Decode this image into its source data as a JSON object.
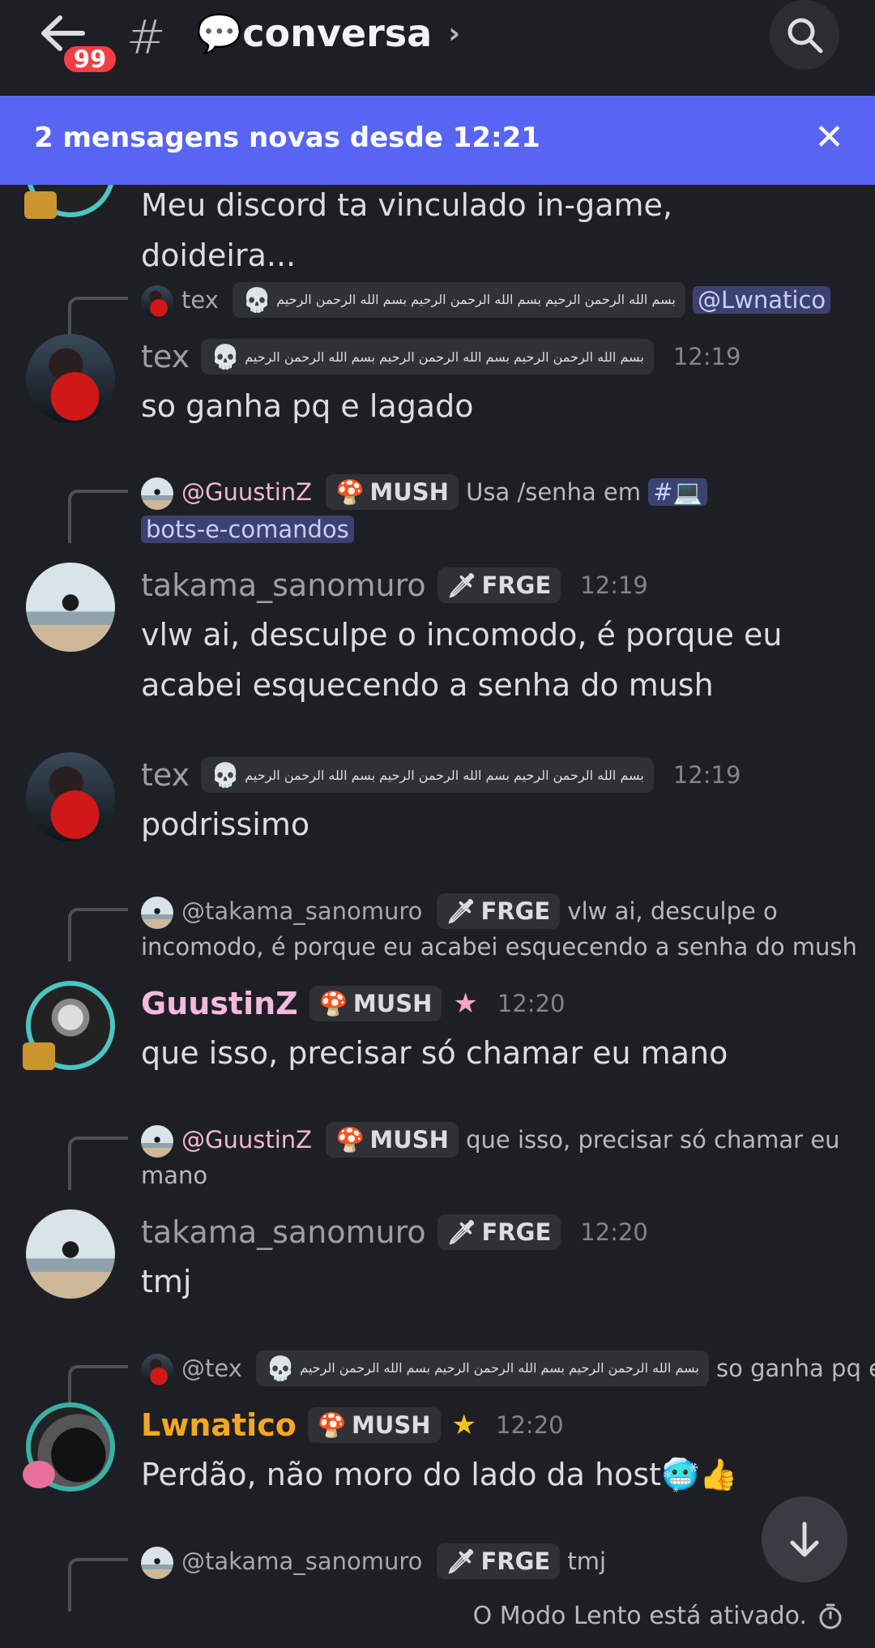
{
  "header": {
    "notification_count": "99",
    "channel_title": "💬conversa",
    "chevron": "›",
    "icons": {
      "back": "arrow-left-icon",
      "hash": "hash-icon",
      "search": "search-icon"
    }
  },
  "banner": {
    "text": "2 mensagens novas desde 12:21",
    "close": "✕"
  },
  "messages": [
    {
      "body": "Meu discord ta vinculado in-game, doideira..."
    },
    {
      "reply": {
        "name": "tex",
        "tag": "بسم الله الرحمن الرحيم بسم الله الرحمن الرحيم بسم الله الرحمن الرحيم",
        "mention": "@Lwnatico"
      },
      "name": "tex",
      "tag": "بسم الله الرحمن الرحيم بسم الله الرحمن الرحيم بسم الله الرحمن الرحيم",
      "time": "12:19",
      "body": "so ganha pq e lagado"
    },
    {
      "reply": {
        "name": "@GuustinZ",
        "tag": "MUSH",
        "text": "Usa /senha em",
        "channel_mention": "#💻",
        "channel_mention_2": "bots-e-comandos"
      },
      "name": "takama_sanomuro",
      "tag": "FRGE",
      "time": "12:19",
      "body": "vlw ai, desculpe o incomodo, é porque eu acabei esquecendo a senha do mush"
    },
    {
      "name": "tex",
      "tag": "بسم الله الرحمن الرحيم بسم الله الرحمن الرحيم بسم الله الرحمن الرحيم",
      "time": "12:19",
      "body": "podrissimo"
    },
    {
      "reply": {
        "name": "@takama_sanomuro",
        "tag": "FRGE",
        "text": "vlw ai, desculpe o",
        "text2": "incomodo, é porque eu acabei esquecendo a senha do mush"
      },
      "name": "GuustinZ",
      "tag": "MUSH",
      "time": "12:20",
      "body": "que isso, precisar só chamar eu mano"
    },
    {
      "reply": {
        "name": "@GuustinZ",
        "tag": "MUSH",
        "text": "que isso, precisar só chamar eu",
        "text2": "mano"
      },
      "name": "takama_sanomuro",
      "tag": "FRGE",
      "time": "12:20",
      "body": "tmj"
    },
    {
      "reply": {
        "name": "@tex",
        "tag": "بسم الله الرحمن الرحيم بسم الله الرحمن الرحيم بسم الله الرحمن الرحيم",
        "text": "so ganha pq e lagado"
      },
      "name": "Lwnatico",
      "tag": "MUSH",
      "time": "12:20",
      "body": "Perdão, não moro do lado da host🥶👍"
    },
    {
      "reply": {
        "name": "@takama_sanomuro",
        "tag": "FRGE",
        "text": "tmj"
      }
    }
  ],
  "footer": {
    "slowmode": "O Modo Lento está ativado.",
    "slowmode_icon": "stopwatch-icon",
    "scroll_icon": "arrow-down-icon"
  },
  "colors": {
    "background": "#1e1f24",
    "banner": "#5865f2",
    "badge": "#f23f43",
    "guustin_name": "#f5b8de",
    "lwnatico_name": "#f5a623"
  }
}
